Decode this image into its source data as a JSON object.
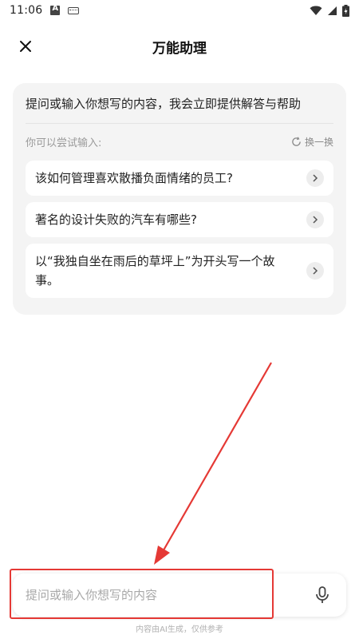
{
  "status_bar": {
    "time": "11:06"
  },
  "header": {
    "title": "万能助理"
  },
  "card": {
    "intro": "提问或输入你想写的内容，我会立即提供解答与帮助",
    "try_label": "你可以尝试输入:",
    "refresh_label": "换一换",
    "suggestions": [
      "该如何管理喜欢散播负面情绪的员工?",
      "著名的设计失败的汽车有哪些?",
      "以“我独自坐在雨后的草坪上”为开头写一个故事。"
    ]
  },
  "input": {
    "placeholder": "提问或输入你想写的内容",
    "value": ""
  },
  "disclaimer": "内容由AI生成，仅供参考",
  "colors": {
    "annotation": "#e53935",
    "card_bg": "#f4f4f4"
  }
}
